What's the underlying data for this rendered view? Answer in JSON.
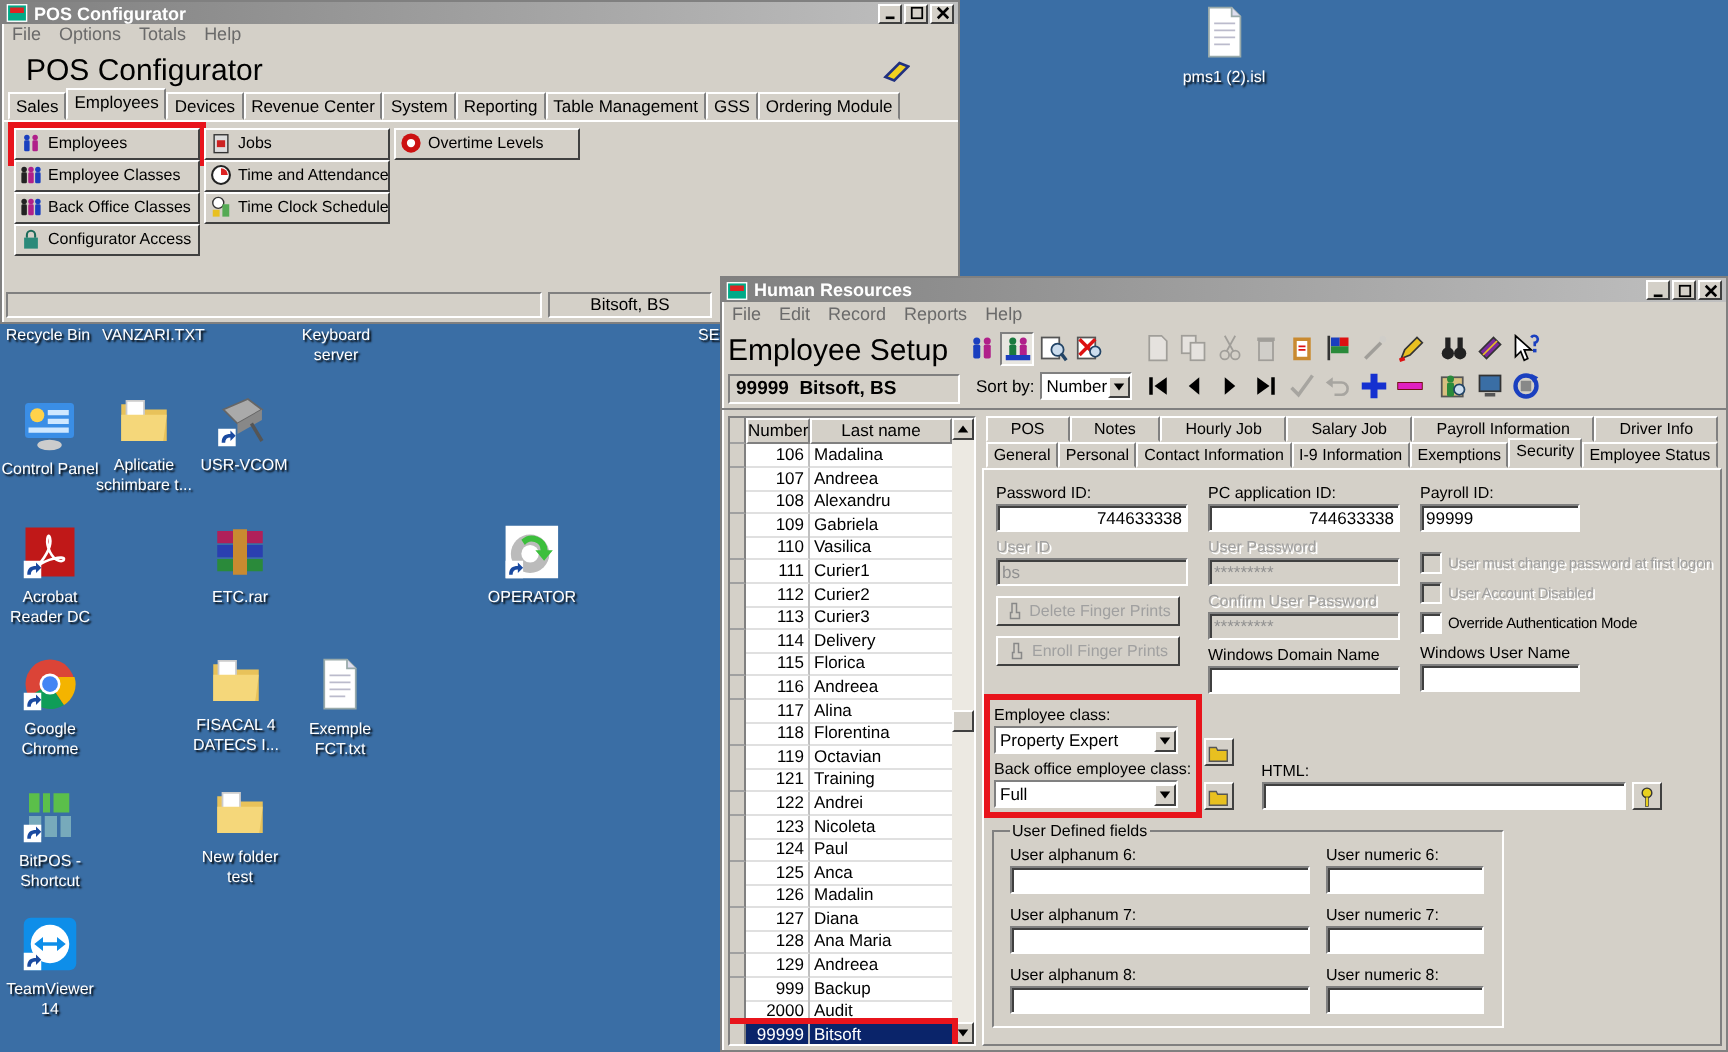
{
  "desktop": {
    "icons": [
      {
        "label": "pms1 (2).isl",
        "kind": "document",
        "shortcut": false
      },
      {
        "label": "Recycle Bin",
        "kind": "label"
      },
      {
        "label": "VANZARI.TXT",
        "kind": "label"
      },
      {
        "label": "Keyboard server",
        "kind": "label"
      },
      {
        "label": "SE",
        "kind": "label"
      },
      {
        "label": "Control Panel",
        "kind": "control-panel",
        "shortcut": false
      },
      {
        "label": "Aplicatie schimbare t...",
        "kind": "folder",
        "shortcut": false
      },
      {
        "label": "USR-VCOM",
        "kind": "device",
        "shortcut": true
      },
      {
        "label": "Acrobat Reader DC",
        "kind": "pdf",
        "shortcut": true
      },
      {
        "label": "ETC.rar",
        "kind": "archive",
        "shortcut": false
      },
      {
        "label": "OPERATOR",
        "kind": "gear",
        "shortcut": true
      },
      {
        "label": "Google Chrome",
        "kind": "browser",
        "shortcut": true
      },
      {
        "label": "FISACAL 4 DATECS I...",
        "kind": "folder",
        "shortcut": false
      },
      {
        "label": "Exemple FCT.txt",
        "kind": "document",
        "shortcut": false
      },
      {
        "label": "BitPOS - Shortcut",
        "kind": "logo",
        "shortcut": true
      },
      {
        "label": "New folder test",
        "kind": "folder",
        "shortcut": false
      },
      {
        "label": "TeamViewer 14",
        "kind": "remote",
        "shortcut": true
      }
    ]
  },
  "pos_window": {
    "title": "POS Configurator",
    "menu": [
      "File",
      "Options",
      "Totals",
      "Help"
    ],
    "heading": "POS Configurator",
    "tabs": [
      {
        "label": "Sales",
        "selected": false
      },
      {
        "label": "Employees",
        "selected": true
      },
      {
        "label": "Devices",
        "selected": false
      },
      {
        "label": "Revenue Center",
        "selected": false
      },
      {
        "label": "System",
        "selected": false
      },
      {
        "label": "Reporting",
        "selected": false
      },
      {
        "label": "Table Management",
        "selected": false
      },
      {
        "label": "GSS",
        "selected": false
      },
      {
        "label": "Ordering Module",
        "selected": false
      }
    ],
    "button_columns": [
      [
        {
          "label": "Employees",
          "kind": "people",
          "highlighted": true
        },
        {
          "label": "Employee Classes",
          "kind": "people-group",
          "highlighted": false
        },
        {
          "label": "Back Office Classes",
          "kind": "people-group",
          "highlighted": false
        },
        {
          "label": "Configurator Access",
          "kind": "lock",
          "highlighted": false
        }
      ],
      [
        {
          "label": "Jobs",
          "kind": "badge",
          "highlighted": false
        },
        {
          "label": "Time and Attendance",
          "kind": "clock",
          "highlighted": false
        },
        {
          "label": "Time Clock Schedule",
          "kind": "schedule",
          "highlighted": false
        }
      ],
      [
        {
          "label": "Overtime Levels",
          "kind": "stop",
          "highlighted": false
        }
      ]
    ],
    "status_user": "Bitsoft, BS"
  },
  "hr_window": {
    "title": "Human Resources",
    "menu": [
      "File",
      "Edit",
      "Record",
      "Reports",
      "Help"
    ],
    "heading": "Employee Setup",
    "current_employee": "99999  Bitsoft, BS",
    "toolbar": {
      "view_tools": [
        {
          "kind": "people",
          "disabled": false,
          "pressed": false
        },
        {
          "kind": "people-list",
          "disabled": false,
          "pressed": true
        },
        {
          "kind": "search",
          "disabled": false,
          "pressed": false
        },
        {
          "kind": "delete-search",
          "disabled": false,
          "pressed": false
        }
      ],
      "record_tools": [
        {
          "kind": "document",
          "disabled": true
        },
        {
          "kind": "copy",
          "disabled": true
        },
        {
          "kind": "cut",
          "disabled": true
        },
        {
          "kind": "trash",
          "disabled": true
        },
        {
          "kind": "clipboard",
          "disabled": false
        },
        {
          "kind": "flag",
          "disabled": false
        },
        {
          "kind": "wand",
          "disabled": true
        },
        {
          "kind": "pen",
          "disabled": false
        }
      ],
      "extra_top": [
        {
          "kind": "binoculars",
          "disabled": false
        },
        {
          "kind": "book",
          "disabled": false
        },
        {
          "kind": "help",
          "disabled": false
        }
      ],
      "sort": {
        "label": "Sort by:",
        "value": "Number"
      },
      "nav_tools": [
        {
          "kind": "first",
          "disabled": false
        },
        {
          "kind": "prev",
          "disabled": false
        },
        {
          "kind": "next",
          "disabled": false
        },
        {
          "kind": "last",
          "disabled": false
        },
        {
          "kind": "check",
          "disabled": true
        },
        {
          "kind": "undo",
          "disabled": true
        },
        {
          "kind": "plus",
          "disabled": false
        },
        {
          "kind": "minus",
          "disabled": false
        }
      ],
      "extra_bottom": [
        {
          "kind": "person-search",
          "disabled": false
        },
        {
          "kind": "monitor",
          "disabled": false
        },
        {
          "kind": "refresh",
          "disabled": false
        }
      ]
    },
    "list": {
      "columns": [
        "Number",
        "Last name"
      ],
      "rows": [
        {
          "number": "106",
          "last_name": "Madalina",
          "selected": false,
          "highlighted": false
        },
        {
          "number": "107",
          "last_name": "Andreea",
          "selected": false,
          "highlighted": false
        },
        {
          "number": "108",
          "last_name": "Alexandru",
          "selected": false,
          "highlighted": false
        },
        {
          "number": "109",
          "last_name": "Gabriela",
          "selected": false,
          "highlighted": false
        },
        {
          "number": "110",
          "last_name": "Vasilica",
          "selected": false,
          "highlighted": false
        },
        {
          "number": "111",
          "last_name": "Curier1",
          "selected": false,
          "highlighted": false
        },
        {
          "number": "112",
          "last_name": "Curier2",
          "selected": false,
          "highlighted": false
        },
        {
          "number": "113",
          "last_name": "Curier3",
          "selected": false,
          "highlighted": false
        },
        {
          "number": "114",
          "last_name": "Delivery",
          "selected": false,
          "highlighted": false
        },
        {
          "number": "115",
          "last_name": "Florica",
          "selected": false,
          "highlighted": false
        },
        {
          "number": "116",
          "last_name": "Andreea",
          "selected": false,
          "highlighted": false
        },
        {
          "number": "117",
          "last_name": "Alina",
          "selected": false,
          "highlighted": false
        },
        {
          "number": "118",
          "last_name": "Florentina",
          "selected": false,
          "highlighted": false
        },
        {
          "number": "119",
          "last_name": "Octavian",
          "selected": false,
          "highlighted": false
        },
        {
          "number": "121",
          "last_name": "Training",
          "selected": false,
          "highlighted": false
        },
        {
          "number": "122",
          "last_name": "Andrei",
          "selected": false,
          "highlighted": false
        },
        {
          "number": "123",
          "last_name": "Nicoleta",
          "selected": false,
          "highlighted": false
        },
        {
          "number": "124",
          "last_name": "Paul",
          "selected": false,
          "highlighted": false
        },
        {
          "number": "125",
          "last_name": "Anca",
          "selected": false,
          "highlighted": false
        },
        {
          "number": "126",
          "last_name": "Madalin",
          "selected": false,
          "highlighted": false
        },
        {
          "number": "127",
          "last_name": "Diana",
          "selected": false,
          "highlighted": false
        },
        {
          "number": "128",
          "last_name": "Ana Maria",
          "selected": false,
          "highlighted": false
        },
        {
          "number": "129",
          "last_name": "Andreea",
          "selected": false,
          "highlighted": false
        },
        {
          "number": "999",
          "last_name": "Backup",
          "selected": false,
          "highlighted": false
        },
        {
          "number": "2000",
          "last_name": "Audit",
          "selected": false,
          "highlighted": false
        },
        {
          "number": "99999",
          "last_name": "Bitsoft",
          "selected": true,
          "highlighted": true
        }
      ]
    },
    "tabs_back": [
      {
        "label": "POS",
        "selected": false
      },
      {
        "label": "Notes",
        "selected": false
      },
      {
        "label": "Hourly Job",
        "selected": false
      },
      {
        "label": "Salary Job",
        "selected": false
      },
      {
        "label": "Payroll Information",
        "selected": false
      },
      {
        "label": "Driver Info",
        "selected": false
      }
    ],
    "tabs_front": [
      {
        "label": "General",
        "selected": false
      },
      {
        "label": "Personal",
        "selected": false
      },
      {
        "label": "Contact Information",
        "selected": false
      },
      {
        "label": "I-9 Information",
        "selected": false
      },
      {
        "label": "Exemptions",
        "selected": false
      },
      {
        "label": "Security",
        "selected": true
      },
      {
        "label": "Employee Status",
        "selected": false
      }
    ],
    "security": {
      "password_id": {
        "label": "Password ID:",
        "value": "744633338",
        "disabled": false
      },
      "pc_application_id": {
        "label": "PC application ID:",
        "value": "744633338",
        "disabled": false
      },
      "payroll_id": {
        "label": "Payroll ID:",
        "value": "99999",
        "disabled": false
      },
      "user_id": {
        "label": "User ID",
        "value": "bs",
        "disabled": true
      },
      "user_password": {
        "label": "User Password",
        "value": "*********",
        "disabled": true
      },
      "confirm_user_password": {
        "label": "Confirm User Password",
        "value": "*********",
        "disabled": true
      },
      "windows_domain_name": {
        "label": "Windows Domain Name",
        "disabled": false
      },
      "windows_user_name": {
        "label": "Windows User Name",
        "disabled": false
      },
      "checkboxes": [
        {
          "label": "User must change password at first logon",
          "checked": false,
          "disabled": true
        },
        {
          "label": "User Account Disabled",
          "checked": false,
          "disabled": true
        },
        {
          "label": "Override Authentication Mode",
          "checked": false,
          "disabled": false
        }
      ],
      "finger_buttons": [
        {
          "label": "Delete Finger Prints",
          "disabled": true
        },
        {
          "label": "Enroll Finger Prints",
          "disabled": true
        }
      ],
      "class_fields": {
        "highlighted": true,
        "items": [
          {
            "label": "Employee class:",
            "value": "Property Expert"
          },
          {
            "label": "Back office employee class:",
            "value": "Full"
          }
        ]
      },
      "html": {
        "label": "HTML:"
      },
      "user_defined": {
        "title": "User Defined fields",
        "alphanumeric": [
          {
            "label": "User alphanum 6:"
          },
          {
            "label": "User alphanum 7:"
          },
          {
            "label": "User alphanum 8:"
          }
        ],
        "numeric": [
          {
            "label": "User numeric 6:"
          },
          {
            "label": "User numeric 7:"
          },
          {
            "label": "User numeric 8:"
          }
        ]
      }
    }
  }
}
